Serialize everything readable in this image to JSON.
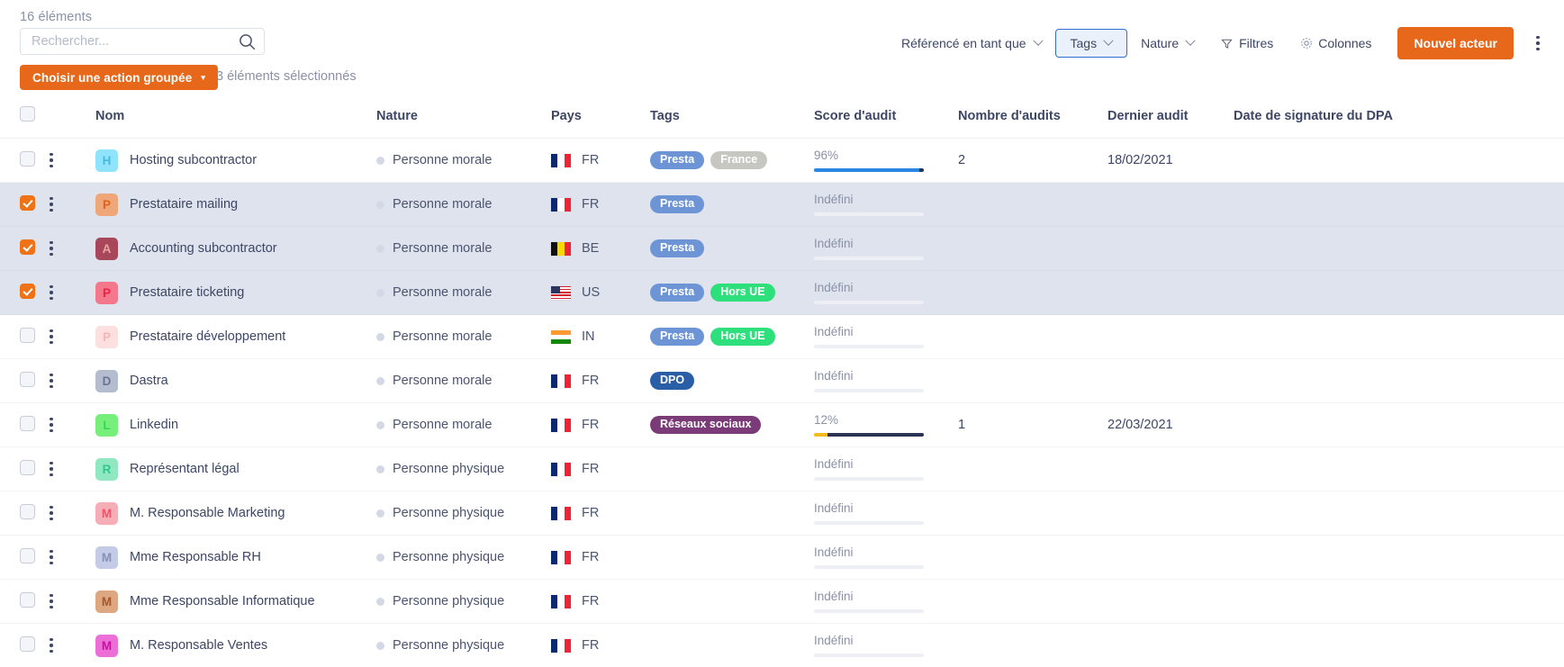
{
  "toolbar": {
    "count_label": "16 éléments",
    "search_placeholder": "Rechercher...",
    "search_value": "",
    "search_icon": "search-icon",
    "bulk_action_label": "Choisir une action groupée",
    "bulk_caret": "▾",
    "selected_label": "3 éléments sélectionnés",
    "filters": [
      {
        "label": "Référencé en tant que",
        "has_chevron": true,
        "active": false
      },
      {
        "label": "Tags",
        "has_chevron": true,
        "active": true
      },
      {
        "label": "Nature",
        "has_chevron": true,
        "active": false
      }
    ],
    "filtres_label": "Filtres",
    "colonnes_label": "Colonnes",
    "new_actor_label": "Nouvel acteur",
    "kebab_icon": "more-vertical-icon",
    "accent_color": "#e8681b",
    "active_filter_border": "#2f6fd0",
    "active_filter_bg": "#eaf1fb"
  },
  "table": {
    "headers": {
      "nom": "Nom",
      "nature": "Nature",
      "pays": "Pays",
      "tags": "Tags",
      "score": "Score d'audit",
      "nombre": "Nombre d'audits",
      "dernier": "Dernier audit",
      "dpa": "Date de signature du DPA"
    },
    "undefined_label": "Indéfini",
    "rows": [
      {
        "selected": false,
        "initial": "H",
        "avatar_bg": "#8fe3fb",
        "avatar_fg": "#4ab9e0",
        "name": "Hosting subcontractor",
        "nature": "Personne morale",
        "country_code": "FR",
        "flag": "fr",
        "tags": [
          {
            "label": "Presta",
            "bg": "#6d95d6"
          },
          {
            "label": "France",
            "bg": "#c7c7c2"
          }
        ],
        "score": "96%",
        "score_value": 96,
        "score_defined": true,
        "bar_fill": "#2a86e0",
        "audits": "2",
        "last_audit": "18/02/2021",
        "dpa_date": ""
      },
      {
        "selected": true,
        "initial": "P",
        "avatar_bg": "#efa679",
        "avatar_fg": "#e3601c",
        "name": "Prestataire mailing",
        "nature": "Personne morale",
        "country_code": "FR",
        "flag": "fr",
        "tags": [
          {
            "label": "Presta",
            "bg": "#6d95d6"
          }
        ],
        "score": "Indéfini",
        "score_value": 0,
        "score_defined": false,
        "bar_fill": "",
        "audits": "",
        "last_audit": "",
        "dpa_date": ""
      },
      {
        "selected": true,
        "initial": "A",
        "avatar_bg": "#a8475a",
        "avatar_fg": "#e8a5a5",
        "name": "Accounting subcontractor",
        "nature": "Personne morale",
        "country_code": "BE",
        "flag": "be",
        "tags": [
          {
            "label": "Presta",
            "bg": "#6d95d6"
          }
        ],
        "score": "Indéfini",
        "score_value": 0,
        "score_defined": false,
        "bar_fill": "",
        "audits": "",
        "last_audit": "",
        "dpa_date": ""
      },
      {
        "selected": true,
        "initial": "P",
        "avatar_bg": "#f4788c",
        "avatar_fg": "#f01f44",
        "name": "Prestataire ticketing",
        "nature": "Personne morale",
        "country_code": "US",
        "flag": "us",
        "tags": [
          {
            "label": "Presta",
            "bg": "#6d95d6"
          },
          {
            "label": "Hors UE",
            "bg": "#2ee07c"
          }
        ],
        "score": "Indéfini",
        "score_value": 0,
        "score_defined": false,
        "bar_fill": "",
        "audits": "",
        "last_audit": "",
        "dpa_date": ""
      },
      {
        "selected": false,
        "initial": "P",
        "avatar_bg": "#fce0e0",
        "avatar_fg": "#f7b5b5",
        "name": "Prestataire développement",
        "nature": "Personne morale",
        "country_code": "IN",
        "flag": "in",
        "tags": [
          {
            "label": "Presta",
            "bg": "#6d95d6"
          },
          {
            "label": "Hors UE",
            "bg": "#2ee07c"
          }
        ],
        "score": "Indéfini",
        "score_value": 0,
        "score_defined": false,
        "bar_fill": "",
        "audits": "",
        "last_audit": "",
        "dpa_date": ""
      },
      {
        "selected": false,
        "initial": "D",
        "avatar_bg": "#b4bccf",
        "avatar_fg": "#6b7491",
        "name": "Dastra",
        "nature": "Personne morale",
        "country_code": "FR",
        "flag": "fr",
        "tags": [
          {
            "label": "DPO",
            "bg": "#2a5fa8"
          }
        ],
        "score": "Indéfini",
        "score_value": 0,
        "score_defined": false,
        "bar_fill": "",
        "audits": "",
        "last_audit": "",
        "dpa_date": ""
      },
      {
        "selected": false,
        "initial": "L",
        "avatar_bg": "#76f07b",
        "avatar_fg": "#3cd455",
        "name": "Linkedin",
        "nature": "Personne morale",
        "country_code": "FR",
        "flag": "fr",
        "tags": [
          {
            "label": "Réseaux sociaux",
            "bg": "#7b3b78"
          }
        ],
        "score": "12%",
        "score_value": 12,
        "score_defined": true,
        "bar_fill": "#f5bb1d",
        "audits": "1",
        "last_audit": "22/03/2021",
        "dpa_date": ""
      },
      {
        "selected": false,
        "initial": "R",
        "avatar_bg": "#8fe8c0",
        "avatar_fg": "#2fc78c",
        "name": "Représentant légal",
        "nature": "Personne physique",
        "country_code": "FR",
        "flag": "fr",
        "tags": [],
        "score": "Indéfini",
        "score_value": 0,
        "score_defined": false,
        "bar_fill": "",
        "audits": "",
        "last_audit": "",
        "dpa_date": ""
      },
      {
        "selected": false,
        "initial": "M",
        "avatar_bg": "#f5aeb6",
        "avatar_fg": "#e8556a",
        "name": "M. Responsable Marketing",
        "nature": "Personne physique",
        "country_code": "FR",
        "flag": "fr",
        "tags": [],
        "score": "Indéfini",
        "score_value": 0,
        "score_defined": false,
        "bar_fill": "",
        "audits": "",
        "last_audit": "",
        "dpa_date": ""
      },
      {
        "selected": false,
        "initial": "M",
        "avatar_bg": "#c4cbe6",
        "avatar_fg": "#8690b5",
        "name": "Mme Responsable RH",
        "nature": "Personne physique",
        "country_code": "FR",
        "flag": "fr",
        "tags": [],
        "score": "Indéfini",
        "score_value": 0,
        "score_defined": false,
        "bar_fill": "",
        "audits": "",
        "last_audit": "",
        "dpa_date": ""
      },
      {
        "selected": false,
        "initial": "M",
        "avatar_bg": "#dda782",
        "avatar_fg": "#a1582a",
        "name": "Mme Responsable Informatique",
        "nature": "Personne physique",
        "country_code": "FR",
        "flag": "fr",
        "tags": [],
        "score": "Indéfini",
        "score_value": 0,
        "score_defined": false,
        "bar_fill": "",
        "audits": "",
        "last_audit": "",
        "dpa_date": ""
      },
      {
        "selected": false,
        "initial": "M",
        "avatar_bg": "#ec6fd8",
        "avatar_fg": "#c4129f",
        "name": "M. Responsable Ventes",
        "nature": "Personne physique",
        "country_code": "FR",
        "flag": "fr",
        "tags": [],
        "score": "Indéfini",
        "score_value": 0,
        "score_defined": false,
        "bar_fill": "",
        "audits": "",
        "last_audit": "",
        "dpa_date": ""
      }
    ]
  }
}
